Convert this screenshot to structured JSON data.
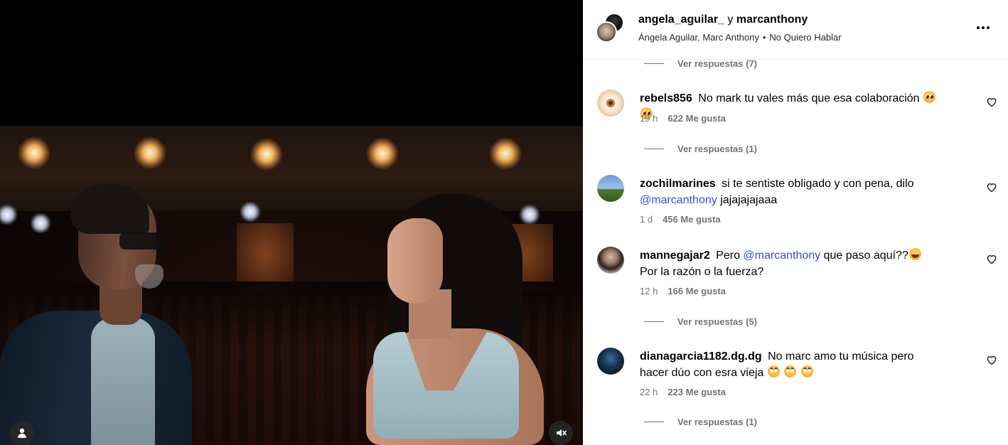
{
  "header": {
    "user_one": "angela_aguilar_",
    "conjunction": "y",
    "user_two": "marcanthony",
    "artists": "Ángela Aguilar, Marc Anthony",
    "separator": "•",
    "song": "No Quiero Hablar",
    "more_icon": "more-horizontal-icon"
  },
  "video": {
    "users_icon": "user-tag-icon",
    "mute_icon": "speaker-muted-icon"
  },
  "replies_toggles": [
    {
      "label": "Ver respuestas (7)"
    },
    {
      "label": "Ver respuestas (1)"
    },
    {
      "label": "Ver respuestas (5)"
    },
    {
      "label": "Ver respuestas (1)"
    }
  ],
  "comments": [
    {
      "username": "rebels856",
      "text": "No mark tu vales más que esa colaboración",
      "emojis": "pleading-face pleading-face",
      "time": "19 h",
      "likes": "622 Me gusta"
    },
    {
      "username": "zochilmarines",
      "text_before": "si te sentiste obligado y con pena, dilo",
      "mention": "@marcanthony",
      "text_after": "jajajajajaaa",
      "time": "1 d",
      "likes": "456 Me gusta"
    },
    {
      "username": "mannegajar2",
      "text_before": "Pero",
      "mention": "@marcanthony",
      "text_after": "que paso aquí??",
      "text_end": "Por la razón o la fuerza?",
      "emojis": "laughing-face",
      "time": "12 h",
      "likes": "166 Me gusta"
    },
    {
      "username": "dianagarcia1182.dg.dg",
      "text": "No marc amo tu música pero hacer dúo con esra vieja",
      "emojis": "face-with-rolling-eyes x3",
      "time": "22 h",
      "likes": "223 Me gusta"
    }
  ],
  "colors": {
    "mention": "#3b4cdb",
    "meta_text": "#737373",
    "divider": "#efefef"
  }
}
